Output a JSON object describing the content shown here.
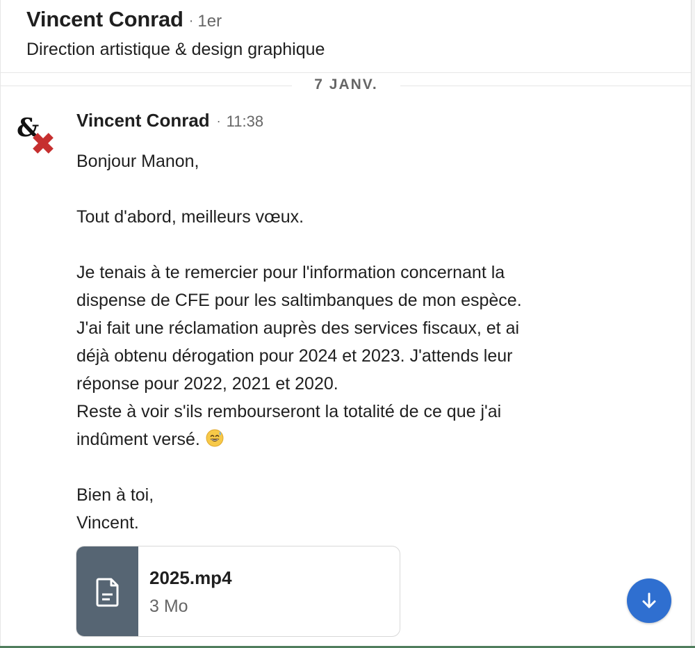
{
  "header": {
    "name": "Vincent Conrad",
    "degree": "1er",
    "separator": "·",
    "headline": "Direction artistique & design graphique"
  },
  "date_divider": {
    "label": "7 JANV."
  },
  "message": {
    "sender": "Vincent Conrad",
    "separator": "·",
    "time": "11:38",
    "avatar_icon": "ampersand-cross-logo",
    "lines": {
      "l1": "Bonjour Manon,",
      "l2": "Tout d'abord, meilleurs vœux.",
      "l3": "Je tenais à te remercier pour l'information concernant la",
      "l4": "dispense de CFE pour les saltimbanques de mon espèce.",
      "l5": "J'ai fait une réclamation auprès des services fiscaux, et ai",
      "l6": "déjà obtenu dérogation pour 2024 et 2023. J'attends leur",
      "l7": "réponse pour 2022, 2021 et 2020.",
      "l8": "Reste à voir s'ils rembourseront la totalité de ce que j'ai",
      "l9": "indûment versé.",
      "l10": "Bien à toi,",
      "l11": "Vincent."
    },
    "emoji_icon": "grinning-sweat-emoji"
  },
  "attachment": {
    "file_name": "2025.mp4",
    "file_size": "3 Mo",
    "icon": "document-icon"
  },
  "scroll_button": {
    "icon": "arrow-down-icon"
  },
  "colors": {
    "scroll_button": "#2f6fd0",
    "attachment_thumb": "#566573",
    "avatar_cross": "#c62f2f"
  }
}
